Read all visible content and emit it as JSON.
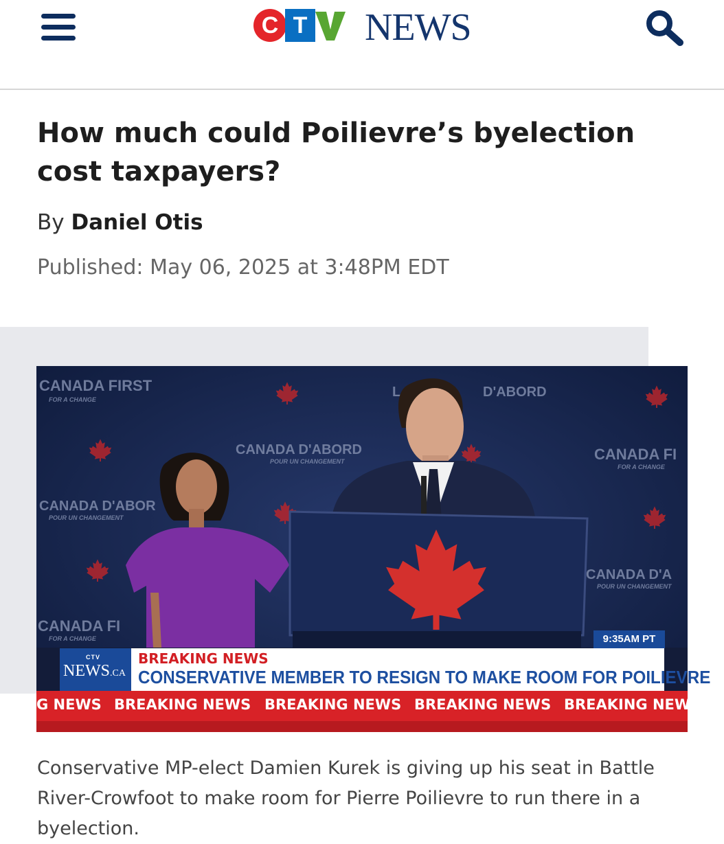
{
  "header": {
    "menu_icon": "hamburger-menu-icon",
    "logo": {
      "c": "C",
      "t": "T",
      "v": "V",
      "news": "NEWS"
    },
    "search_icon": "search-icon"
  },
  "article": {
    "headline": "How much could Poilievre’s byelection cost taxpayers?",
    "by_prefix": "By",
    "author": "Daniel Otis",
    "published": "Published: May 06, 2025 at 3:48PM EDT",
    "caption": "Conservative MP-elect Damien Kurek is giving up his seat in Battle River-Crowfoot to make room for Pierre Poilievre to run there in a byelection."
  },
  "photo": {
    "backdrop_texts": [
      "CANADA FIRST",
      "CANADA D'ABORD",
      "CANADA D'ABOR",
      "CANADA FI",
      "CANADA D'A",
      "CANADA FI",
      "L",
      "D'ABORD"
    ],
    "backdrop_subtexts": [
      "FOR A CHANGE",
      "POUR UN CHANGEMENT"
    ],
    "timestamp": "9:35AM PT",
    "broadcast_logo": {
      "ctv": "CTV",
      "news": "NEWS",
      "ca": ".CA"
    },
    "breaking_label": "BREAKING NEWS",
    "breaking_headline": "CONSERVATIVE MEMBER TO RESIGN TO MAKE ROOM FOR POILIEVRE",
    "ticker": [
      "G NEWS",
      "BREAKING NEWS",
      "BREAKING NEWS",
      "BREAKING NEWS",
      "BREAKING NEW"
    ]
  },
  "colors": {
    "ctv_red": "#e4252a",
    "ctv_blue": "#0a6fc2",
    "ctv_green": "#58a632",
    "news_navy": "#14356d",
    "ticker_red": "#d82227",
    "banner_blue": "#1d4fa0"
  }
}
